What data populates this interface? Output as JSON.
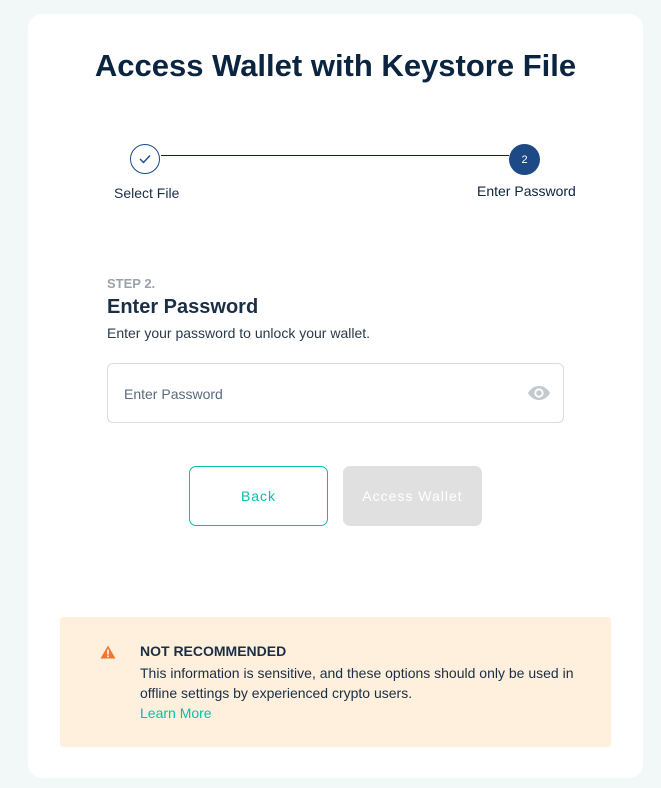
{
  "page": {
    "title": "Access Wallet with Keystore File"
  },
  "stepper": {
    "steps": [
      {
        "label": "Select File",
        "state": "completed"
      },
      {
        "label": "Enter Password",
        "number": "2",
        "state": "active"
      }
    ],
    "accent_color": "#1d4a87"
  },
  "form": {
    "kicker": "STEP 2.",
    "heading": "Enter Password",
    "description": "Enter your password to unlock your wallet.",
    "password_placeholder": "Enter Password",
    "password_value": "",
    "visibility_icon": "eye-icon"
  },
  "buttons": {
    "back_label": "Back",
    "access_label": "Access Wallet",
    "access_disabled": true,
    "primary_color": "#05c0a5"
  },
  "warning": {
    "icon": "warning-triangle-icon",
    "title": "NOT RECOMMENDED",
    "body": "This information is sensitive, and these options should only be used in offline settings by experienced crypto users.",
    "link_label": "Learn More",
    "background_color": "#fef0dc",
    "icon_color": "#f2762e"
  }
}
